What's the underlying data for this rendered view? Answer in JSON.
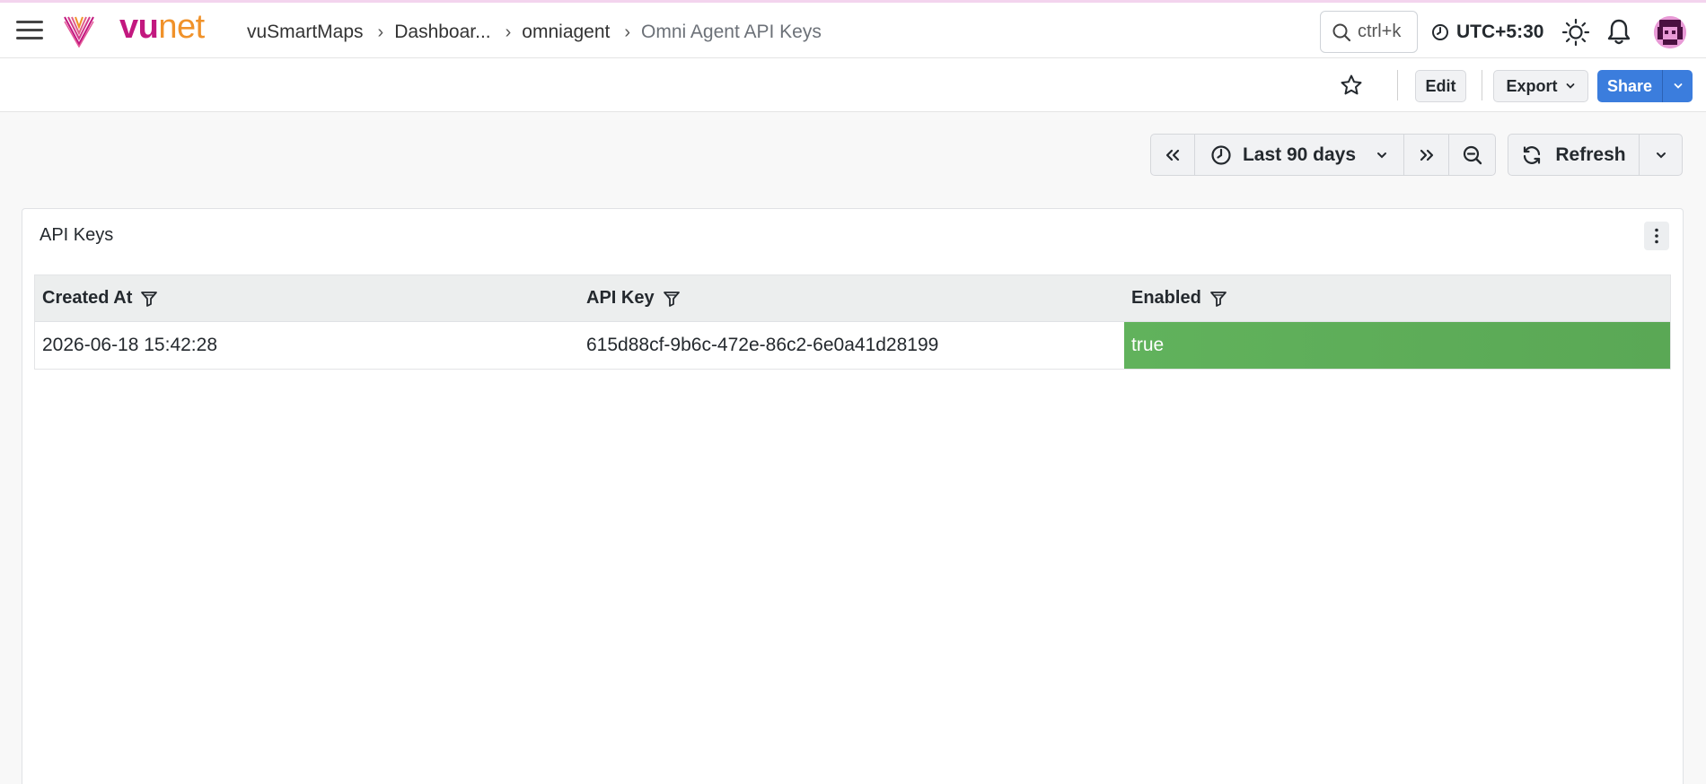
{
  "app": {
    "logo": {
      "part1": "vu",
      "part2": "net"
    },
    "colors": {
      "brand_magenta": "#c2187f",
      "brand_orange": "#f0922a",
      "accent_blue": "#3b7ddd",
      "enabled_green": "#61b25c"
    }
  },
  "breadcrumb": {
    "items": [
      "vuSmartMaps",
      "Dashboar...",
      "omniagent"
    ],
    "current": "Omni Agent API Keys"
  },
  "header": {
    "search_placeholder": "ctrl+k",
    "timezone": "UTC+5:30",
    "icons": [
      "menu-icon",
      "search-icon",
      "clock-icon",
      "sun-icon",
      "bell-icon",
      "avatar"
    ]
  },
  "toolbar": {
    "edit_label": "Edit",
    "export_label": "Export",
    "share_label": "Share"
  },
  "time_picker": {
    "range_label": "Last 90 days",
    "refresh_label": "Refresh"
  },
  "panel": {
    "title": "API Keys",
    "table": {
      "columns": [
        "Created At",
        "API Key",
        "Enabled"
      ],
      "rows": [
        [
          "2026-06-18 15:42:28",
          "615d88cf-9b6c-472e-86c2-6e0a41d28199",
          "true"
        ]
      ]
    }
  }
}
